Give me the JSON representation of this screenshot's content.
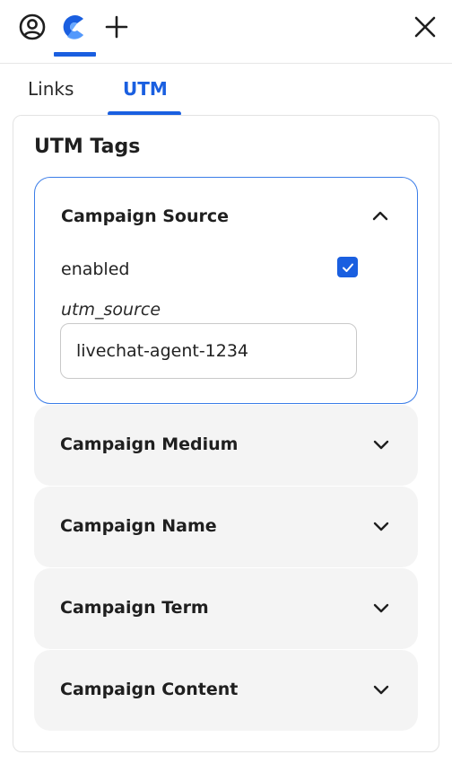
{
  "topbar": {
    "icons": [
      "user-circle-icon",
      "app-logo-icon",
      "plus-icon",
      "close-icon"
    ],
    "accent_color": "#1a5fe0"
  },
  "tabs": [
    {
      "label": "Links",
      "active": false
    },
    {
      "label": "UTM",
      "active": true
    }
  ],
  "panel": {
    "title": "UTM Tags",
    "sections": [
      {
        "label": "Campaign Source",
        "expanded": true,
        "enabled_label": "enabled",
        "enabled": true,
        "field_label": "utm_source",
        "field_value": "livechat-agent-1234"
      },
      {
        "label": "Campaign Medium",
        "expanded": false
      },
      {
        "label": "Campaign Name",
        "expanded": false
      },
      {
        "label": "Campaign Term",
        "expanded": false
      },
      {
        "label": "Campaign Content",
        "expanded": false
      }
    ]
  }
}
